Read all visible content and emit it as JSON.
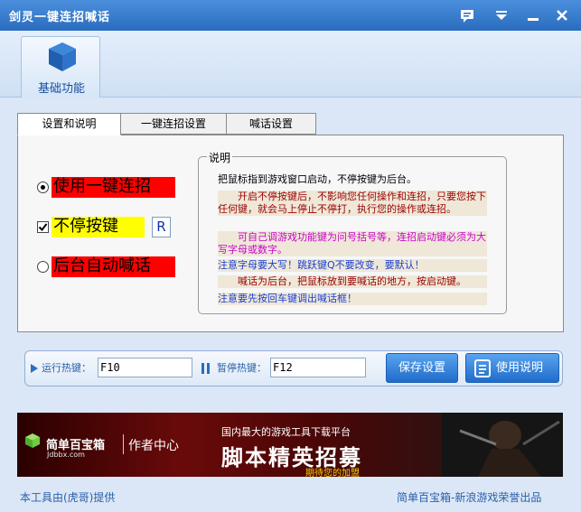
{
  "window": {
    "title": "剑灵一键连招喊话"
  },
  "toolbar": {
    "items": [
      {
        "label": "基础功能",
        "icon": "cube-icon"
      }
    ]
  },
  "tabs": [
    {
      "label": "设置和说明",
      "active": true
    },
    {
      "label": "一键连招设置",
      "active": false
    },
    {
      "label": "喊话设置",
      "active": false
    }
  ],
  "options": {
    "one_key_combo": {
      "label": "使用一键连招",
      "checked": true,
      "bg": "#ff0000"
    },
    "keep_pressing": {
      "label": "不停按键",
      "checked": true,
      "bg": "#ffff00",
      "key_value": "R"
    },
    "auto_shout": {
      "label": "后台自动喊话",
      "checked": false,
      "bg": "#ff0000"
    }
  },
  "notes": {
    "group_title": "说明",
    "lines": [
      {
        "text": "把鼠标指到游戏窗口启动，不停按键为后台。",
        "color": "#000000"
      },
      {
        "text": "开启不停按键后，不影响您任何操作和连招，只要您按下任何键，就会马上停止不停打，执行您的操作或连招。",
        "color": "#9a0000"
      },
      {
        "text": "可自己调游戏功能键为问号括号等，连招启动键必须为大写字母或数字。",
        "color": "#cc00cc"
      },
      {
        "text": "注意字母要大写！跳跃键Q不要改变，要默认！",
        "color": "#1a3fd0"
      },
      {
        "text": "喊话为后台，把鼠标放到要喊话的地方，按启动键。",
        "color": "#9a0000"
      },
      {
        "text": "注意要先按回车键调出喊话框！",
        "color": "#1a3fd0"
      }
    ]
  },
  "hotkeys": {
    "run_label": "运行热键：",
    "run_value": "F10",
    "pause_label": "暂停热键：",
    "pause_value": "F12"
  },
  "buttons": {
    "save": "保存设置",
    "manual": "使用说明"
  },
  "banner": {
    "brand": "简单百宝箱",
    "url": "Jdbbx.com",
    "center": "作者中心",
    "sub": "国内最大的游戏工具下载平台",
    "big": "脚本精英招募",
    "tag": "期待您的加盟"
  },
  "status": {
    "left": "本工具由(虎哥)提供",
    "right": "简单百宝箱-新浪游戏荣誉出品"
  }
}
